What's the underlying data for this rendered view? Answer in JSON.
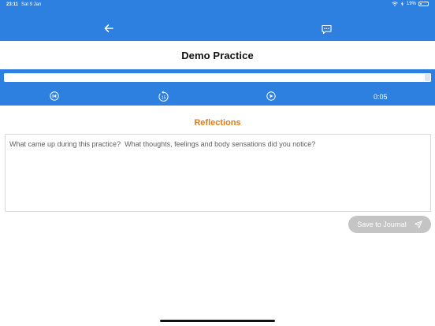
{
  "status_bar": {
    "time": "23:11",
    "date": "Sat 9 Jan",
    "battery_percent": "19%",
    "battery_level": 0.19
  },
  "nav": {
    "back_icon": "arrow-left-icon",
    "chat_icon": "chat-bubble-icon"
  },
  "page": {
    "title": "Demo Practice"
  },
  "player": {
    "progress": 1.0,
    "elapsed_time": "0:05",
    "controls": [
      "skip-to-start-icon",
      "rewind-15-icon",
      "play-icon"
    ],
    "rewind_label": "15"
  },
  "reflections": {
    "heading": "Reflections",
    "placeholder": "What came up during this practice?  What thoughts, feelings and body sensations did you notice?",
    "value": ""
  },
  "save": {
    "label": "Save to Journal",
    "icon": "send-icon"
  },
  "colors": {
    "brand_blue": "#2d7fe0",
    "heading_orange": "#e07c1a",
    "disabled_gray": "#c4c4c4"
  }
}
